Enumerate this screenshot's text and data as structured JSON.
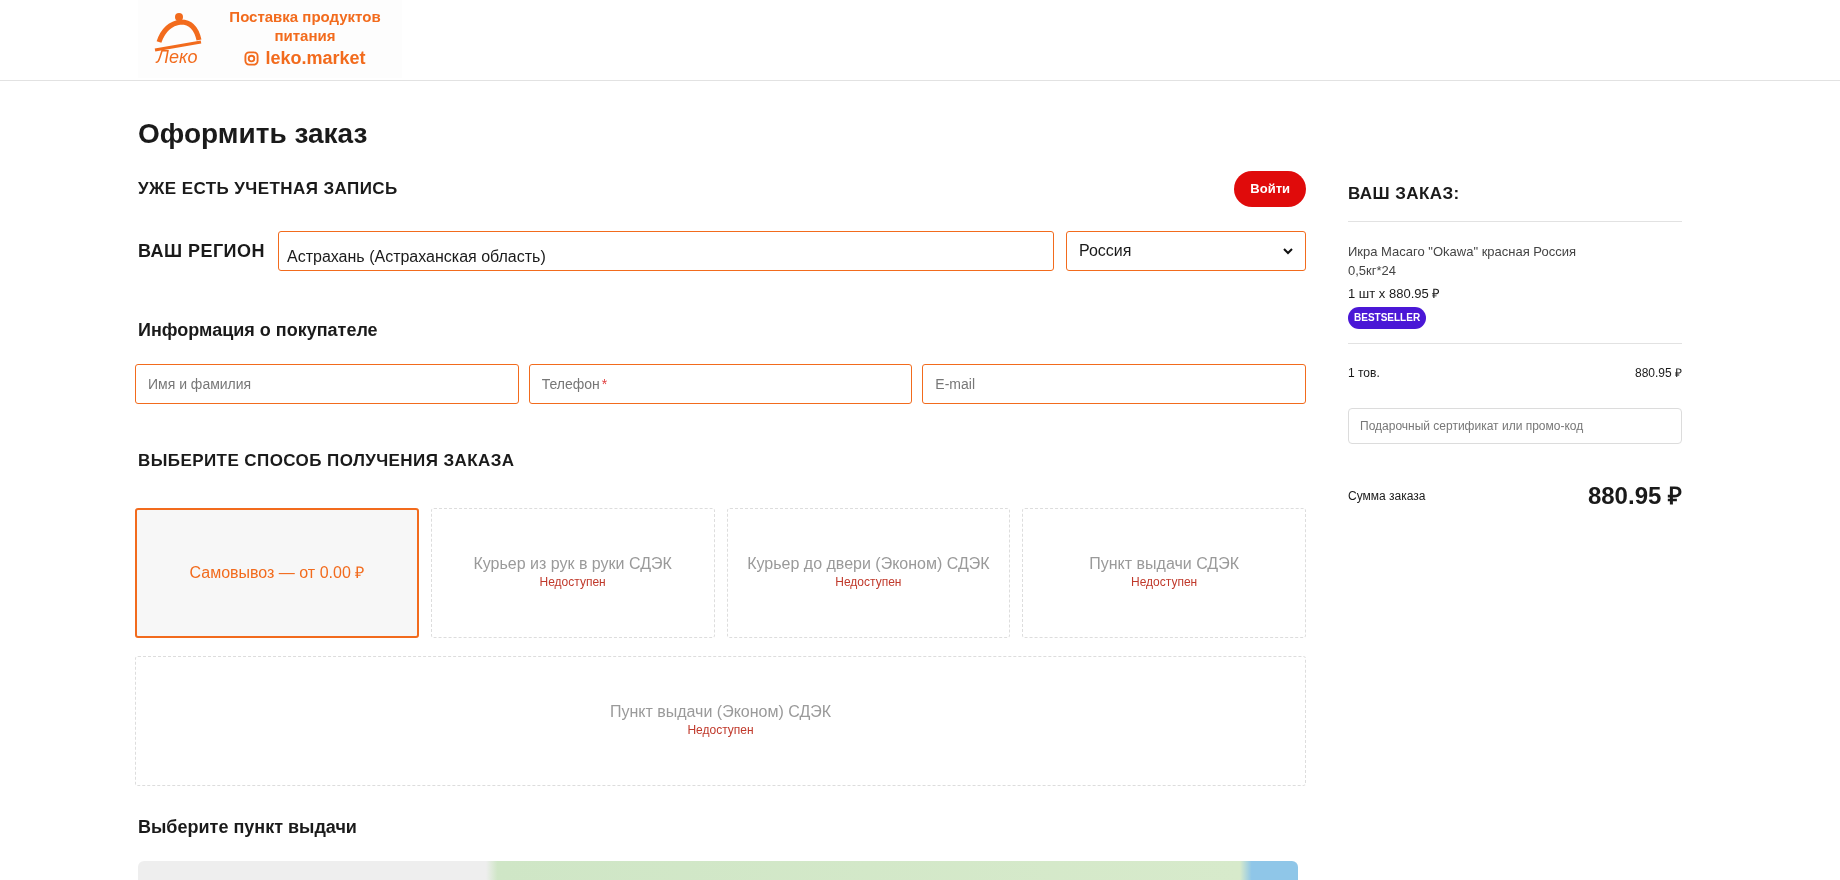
{
  "logo": {
    "wordmark": "Леко",
    "tagline": "Поставка продуктов питания",
    "handle": "leko.market"
  },
  "page_title": "Оформить заказ",
  "account": {
    "heading": "УЖЕ ЕСТЬ УЧЕТНАЯ ЗАПИСЬ",
    "login_button": "Войти"
  },
  "region": {
    "label": "ВАШ РЕГИОН",
    "city": "Астрахань (Астраханская область)",
    "country": "Россия"
  },
  "buyer": {
    "heading": "Информация о покупателе",
    "fields": [
      {
        "placeholder": "Имя и фамилия"
      },
      {
        "placeholder": "Телефон",
        "required_mark": "*"
      },
      {
        "placeholder": "E-mail"
      }
    ]
  },
  "delivery": {
    "heading": "ВЫБЕРИТЕ СПОСОБ ПОЛУЧЕНИЯ ЗАКАЗА",
    "options": [
      {
        "label": "Самовывоз — от 0.00 ₽",
        "selected": true,
        "disabled": false
      },
      {
        "label": "Курьер из рук в руки СДЭК",
        "status": "Недоступен",
        "selected": false,
        "disabled": true
      },
      {
        "label": "Курьер до двери (Эконом) СДЭК",
        "status": "Недоступен",
        "selected": false,
        "disabled": true
      },
      {
        "label": "Пункт выдачи СДЭК",
        "status": "Недоступен",
        "selected": false,
        "disabled": true
      },
      {
        "label": "Пункт выдачи (Эконом) СДЭК",
        "status": "Недоступен",
        "selected": false,
        "disabled": true
      }
    ]
  },
  "pickup": {
    "heading": "Выберите пункт выдачи"
  },
  "order": {
    "heading": "ВАШ ЗАКАЗ:",
    "items": [
      {
        "name": "Икра Масаго \"Okawa\" красная Россия",
        "pack": "0,5кг*24",
        "qty_price": "1 шт x 880.95 ₽",
        "badge": "BESTSELLER"
      }
    ],
    "count": "1 тов.",
    "subtotal": "880.95 ₽",
    "promo_placeholder": "Подарочный сертификат или промо-код",
    "total_label": "Сумма заказа",
    "total": "880.95 ₽"
  }
}
